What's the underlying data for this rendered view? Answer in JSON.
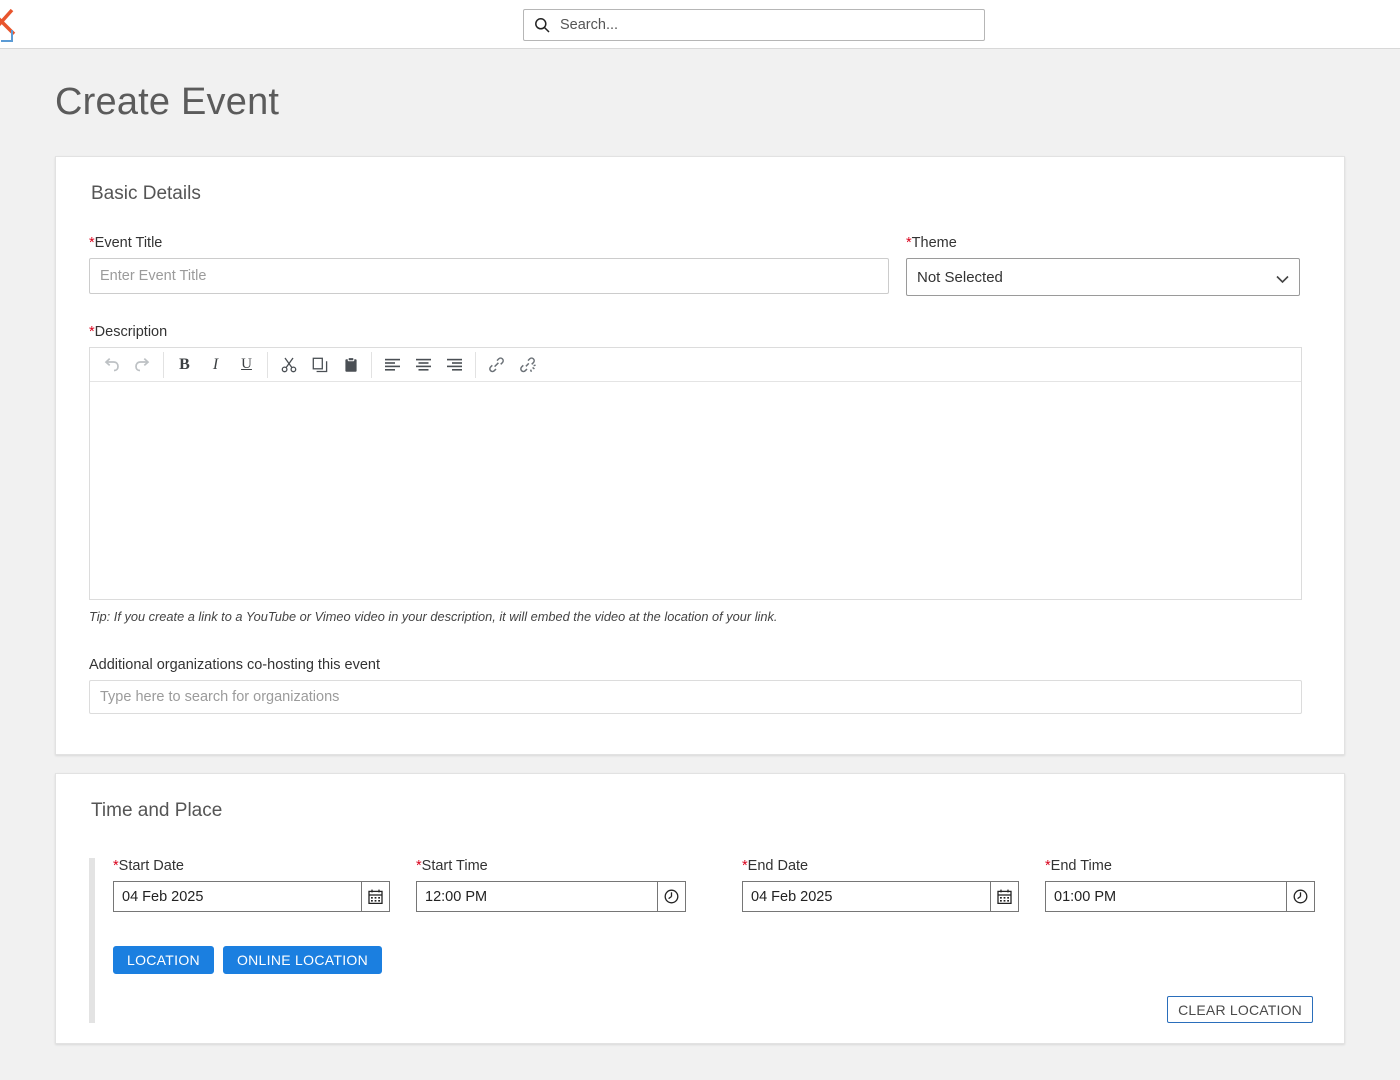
{
  "topbar": {
    "logo_name": "app-logo",
    "search": {
      "placeholder": "Search...",
      "value": "",
      "icon": "search-icon"
    }
  },
  "page": {
    "title": "Create Event"
  },
  "basic_details": {
    "section_title": "Basic Details",
    "event_title": {
      "label": "Event Title",
      "required_marker": "*",
      "placeholder": "Enter Event Title",
      "value": ""
    },
    "theme": {
      "label": "Theme",
      "required_marker": "*",
      "selected": "Not Selected",
      "options": [
        "Not Selected"
      ],
      "chevron_icon": "chevron-down-icon"
    },
    "description": {
      "label": "Description",
      "required_marker": "*",
      "value": "",
      "tip": "Tip: If you create a link to a YouTube or Vimeo video in your description, it will embed the video at the location of your link.",
      "toolbar": [
        {
          "name": "undo-icon",
          "glyph": "↶",
          "disabled": true
        },
        {
          "name": "redo-icon",
          "glyph": "↷",
          "disabled": true
        },
        {
          "sep": true
        },
        {
          "name": "bold-icon",
          "glyph": "B",
          "disabled": false
        },
        {
          "name": "italic-icon",
          "glyph": "I",
          "disabled": false
        },
        {
          "name": "underline-icon",
          "glyph": "U",
          "disabled": false
        },
        {
          "sep": true
        },
        {
          "name": "cut-icon",
          "glyph": "✂",
          "disabled": false
        },
        {
          "name": "copy-icon",
          "glyph": "⧉",
          "disabled": false
        },
        {
          "name": "paste-icon",
          "glyph": "📋",
          "disabled": false
        },
        {
          "sep": true
        },
        {
          "name": "align-left-icon",
          "glyph": "≡",
          "disabled": false
        },
        {
          "name": "align-center-icon",
          "glyph": "≡",
          "disabled": false
        },
        {
          "name": "align-right-icon",
          "glyph": "≡",
          "disabled": false
        },
        {
          "sep": true
        },
        {
          "name": "link-icon",
          "glyph": "🔗",
          "disabled": false
        },
        {
          "name": "unlink-icon",
          "glyph": "⛓",
          "disabled": false
        }
      ]
    },
    "cohost": {
      "label": "Additional organizations co-hosting this event",
      "placeholder": "Type here to search for organizations",
      "value": ""
    }
  },
  "time_and_place": {
    "section_title": "Time and Place",
    "start_date": {
      "label": "Start Date",
      "required_marker": "*",
      "value": "04 Feb 2025",
      "icon": "calendar-icon"
    },
    "start_time": {
      "label": "Start Time",
      "required_marker": "*",
      "value": "12:00 PM",
      "icon": "clock-icon"
    },
    "end_date": {
      "label": "End Date",
      "required_marker": "*",
      "value": "04 Feb 2025",
      "icon": "calendar-icon"
    },
    "end_time": {
      "label": "End Time",
      "required_marker": "*",
      "value": "01:00 PM",
      "icon": "clock-icon"
    },
    "buttons": {
      "location": "LOCATION",
      "online_location": "ONLINE LOCATION",
      "clear_location": "CLEAR LOCATION"
    }
  },
  "colors": {
    "page_bg": "#f1f1f1",
    "card_bg": "#ffffff",
    "primary_blue": "#1b7fe0",
    "outline_blue": "#2a6ebb",
    "required_red": "#d9001b",
    "logo_orange": "#e8552d",
    "logo_blue": "#5b9bd5",
    "accent_bar": "#e3e3e3"
  }
}
